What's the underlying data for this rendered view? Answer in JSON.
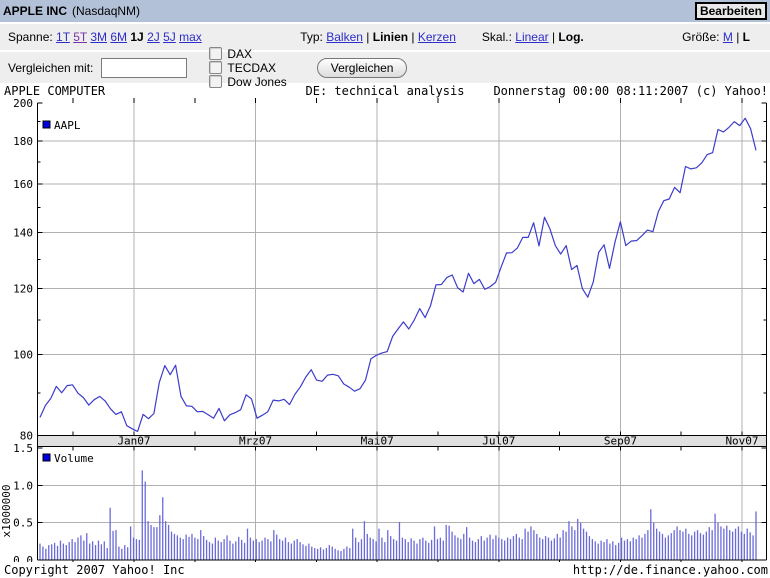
{
  "titlebar": {
    "title": "APPLE INC",
    "subtitle": "(NasdaqNM)",
    "edit_button": "Bearbeiten"
  },
  "toolbar": {
    "spanne_label": "Spanne: ",
    "spanne_options": [
      {
        "label": "1T",
        "state": "link"
      },
      {
        "label": "5T",
        "state": "visited"
      },
      {
        "label": "3M",
        "state": "link"
      },
      {
        "label": "6M",
        "state": "link"
      },
      {
        "label": "1J",
        "state": "selected"
      },
      {
        "label": "2J",
        "state": "link"
      },
      {
        "label": "5J",
        "state": "link"
      },
      {
        "label": "max",
        "state": "link"
      }
    ],
    "typ_label": "Typ: ",
    "typ_options": [
      {
        "label": "Balken",
        "state": "link"
      },
      {
        "label": "Linien",
        "state": "selected"
      },
      {
        "label": "Kerzen",
        "state": "link"
      }
    ],
    "skal_label": "Skal.: ",
    "skal_options": [
      {
        "label": "Linear",
        "state": "link"
      },
      {
        "label": "Log.",
        "state": "selected"
      }
    ],
    "groesse_label": "Größe: ",
    "groesse_options": [
      {
        "label": "M",
        "state": "link"
      },
      {
        "label": "L",
        "state": "selected"
      }
    ]
  },
  "compare": {
    "label": "Vergleichen mit:",
    "input_value": "",
    "checkboxes": [
      "DAX",
      "TECDAX",
      "Dow Jones"
    ],
    "button": "Vergleichen"
  },
  "chart_header": {
    "left": "APPLE COMPUTER",
    "center": "DE: technical analysis",
    "right": "Donnerstag 00:00 08:11:2007 (c) Yahoo!"
  },
  "footer": {
    "left": "Copyright 2007 Yahoo! Inc",
    "right": "http://de.finance.yahoo.com"
  },
  "chart_data": {
    "type": "line",
    "title": "AAPL price with volume, Nov 2006 - Nov 2007",
    "scale": "log",
    "colors": {
      "line": "#3c3ccc",
      "bar": "#6a6ada",
      "legend_square": "#0000e0",
      "grid": "#b0b0b0",
      "axis": "#000000",
      "band_bg": "#e0e0e0"
    },
    "x_axis": {
      "major_labels": [
        "Jan07",
        "Mrz07",
        "Mai07",
        "Jul07",
        "Sep07",
        "Nov07"
      ]
    },
    "price": {
      "legend": "AAPL",
      "ylim": [
        80,
        200
      ],
      "yticks": [
        80,
        100,
        120,
        140,
        160,
        180,
        200
      ],
      "values": [
        84.1,
        86.9,
        88.6,
        91.6,
        90.0,
        91.8,
        92.0,
        89.9,
        88.8,
        87.0,
        88.3,
        89.1,
        88.0,
        86.1,
        84.8,
        85.4,
        82.2,
        81.5,
        80.9,
        84.8,
        83.8,
        85.0,
        92.6,
        97.0,
        94.6,
        97.1,
        89.1,
        86.8,
        86.7,
        85.4,
        85.5,
        84.7,
        83.9,
        86.2,
        83.3,
        84.7,
        85.2,
        85.9,
        89.5,
        88.5,
        83.9,
        84.6,
        85.4,
        88.2,
        88.0,
        88.4,
        87.1,
        89.6,
        91.5,
        94.0,
        95.9,
        93.2,
        92.9,
        94.5,
        94.7,
        94.3,
        92.2,
        91.4,
        90.4,
        91.0,
        93.2,
        98.8,
        99.8,
        100.4,
        100.8,
        105.1,
        107.3,
        109.4,
        107.3,
        110.0,
        113.5,
        110.7,
        114.4,
        121.2,
        121.3,
        123.6,
        124.5,
        120.2,
        118.8,
        125.1,
        121.6,
        123.0,
        119.7,
        120.6,
        122.0,
        127.2,
        132.3,
        132.4,
        134.1,
        138.1,
        138.1,
        143.8,
        134.9,
        146.0,
        141.4,
        135.0,
        131.9,
        135.0,
        126.4,
        127.8,
        119.9,
        117.1,
        122.2,
        132.5,
        135.3,
        126.8,
        136.3,
        144.2,
        135.0,
        136.7,
        136.9,
        138.8,
        140.9,
        140.3,
        148.3,
        152.8,
        153.5,
        158.5,
        156.2,
        167.9,
        166.8,
        167.3,
        169.6,
        173.5,
        174.4,
        185.9,
        184.7,
        187.0,
        190.0,
        187.9,
        191.8,
        186.3,
        175.5
      ]
    },
    "volume": {
      "legend": "Volume",
      "unit_label": "x1000000",
      "ylim": [
        0,
        1.5
      ],
      "yticks": [
        0.0,
        0.5,
        1.0,
        1.5
      ],
      "values": [
        0.22,
        0.18,
        0.15,
        0.2,
        0.21,
        0.23,
        0.19,
        0.26,
        0.22,
        0.2,
        0.24,
        0.28,
        0.24,
        0.3,
        0.33,
        0.26,
        0.36,
        0.22,
        0.25,
        0.2,
        0.26,
        0.21,
        0.25,
        0.16,
        0.7,
        0.39,
        0.4,
        0.18,
        0.15,
        0.2,
        0.17,
        0.45,
        0.3,
        0.28,
        0.27,
        1.2,
        1.05,
        0.52,
        0.47,
        0.44,
        0.44,
        0.6,
        0.84,
        0.52,
        0.47,
        0.38,
        0.35,
        0.33,
        0.3,
        0.28,
        0.34,
        0.31,
        0.35,
        0.3,
        0.28,
        0.4,
        0.32,
        0.27,
        0.24,
        0.22,
        0.3,
        0.26,
        0.24,
        0.28,
        0.33,
        0.26,
        0.22,
        0.25,
        0.31,
        0.27,
        0.23,
        0.42,
        0.3,
        0.26,
        0.28,
        0.24,
        0.26,
        0.3,
        0.28,
        0.25,
        0.4,
        0.34,
        0.28,
        0.26,
        0.3,
        0.24,
        0.22,
        0.26,
        0.28,
        0.24,
        0.21,
        0.19,
        0.22,
        0.18,
        0.16,
        0.15,
        0.17,
        0.14,
        0.16,
        0.2,
        0.18,
        0.15,
        0.13,
        0.12,
        0.15,
        0.18,
        0.16,
        0.42,
        0.3,
        0.24,
        0.28,
        0.52,
        0.35,
        0.3,
        0.28,
        0.25,
        0.42,
        0.3,
        0.24,
        0.4,
        0.32,
        0.28,
        0.26,
        0.51,
        0.3,
        0.28,
        0.24,
        0.29,
        0.26,
        0.22,
        0.28,
        0.3,
        0.26,
        0.23,
        0.27,
        0.45,
        0.28,
        0.3,
        0.26,
        0.47,
        0.46,
        0.38,
        0.33,
        0.3,
        0.28,
        0.35,
        0.44,
        0.3,
        0.26,
        0.24,
        0.28,
        0.32,
        0.26,
        0.3,
        0.34,
        0.28,
        0.33,
        0.3,
        0.28,
        0.26,
        0.3,
        0.28,
        0.32,
        0.35,
        0.3,
        0.28,
        0.42,
        0.38,
        0.45,
        0.4,
        0.35,
        0.3,
        0.28,
        0.32,
        0.3,
        0.26,
        0.29,
        0.35,
        0.3,
        0.4,
        0.38,
        0.52,
        0.45,
        0.4,
        0.55,
        0.5,
        0.42,
        0.38,
        0.32,
        0.28,
        0.25,
        0.22,
        0.26,
        0.24,
        0.28,
        0.22,
        0.25,
        0.2,
        0.23,
        0.3,
        0.26,
        0.28,
        0.25,
        0.3,
        0.28,
        0.33,
        0.3,
        0.35,
        0.4,
        0.68,
        0.5,
        0.42,
        0.38,
        0.35,
        0.3,
        0.33,
        0.36,
        0.4,
        0.45,
        0.4,
        0.38,
        0.42,
        0.35,
        0.33,
        0.38,
        0.4,
        0.36,
        0.34,
        0.38,
        0.44,
        0.4,
        0.62,
        0.5,
        0.45,
        0.42,
        0.46,
        0.4,
        0.38,
        0.42,
        0.45,
        0.38,
        0.35,
        0.42,
        0.37,
        0.33,
        0.65
      ]
    }
  }
}
